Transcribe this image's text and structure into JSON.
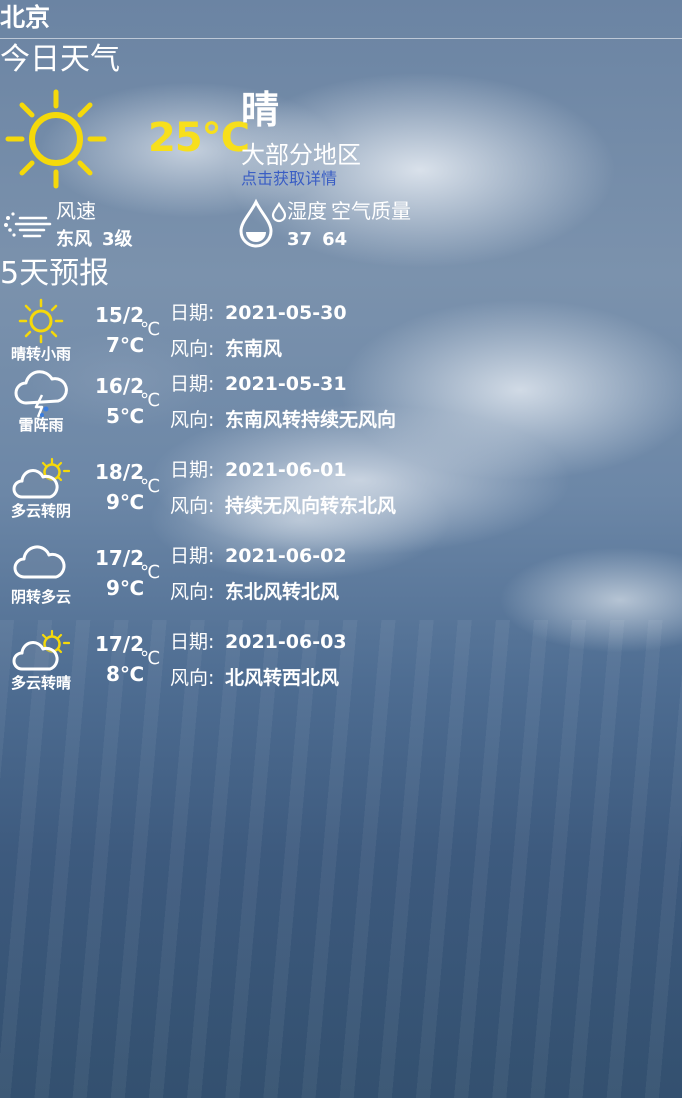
{
  "header": {
    "city": "北京"
  },
  "today": {
    "section_title": "今日天气",
    "weather_icon": "sun-icon",
    "temperature": "25℃",
    "weather": "晴",
    "area": "大部分地区",
    "detail_link": "点击获取详情",
    "wind": {
      "icon": "wind-icon",
      "label": "风速",
      "direction": "东风",
      "level": "3级"
    },
    "humidity": {
      "icon": "water-drop-icon",
      "label": "湿度",
      "aqi_label": "空气质量",
      "humidity_value": "37",
      "aqi_value": "64"
    }
  },
  "forecast": {
    "section_title": "5天预报",
    "date_label": "日期:",
    "wind_label": "风向:",
    "temp_unit": "℃",
    "days": [
      {
        "icon": "sun-to-light-rain-icon",
        "condition": "晴转小雨",
        "high": "15/2",
        "low": "7℃",
        "date": "2021-05-30",
        "wind": "东南风"
      },
      {
        "icon": "thunderstorm-icon",
        "condition": "雷阵雨",
        "high": "16/2",
        "low": "5℃",
        "date": "2021-05-31",
        "wind": "东南风转持续无风向"
      },
      {
        "icon": "partly-cloudy-icon",
        "condition": "多云转阴",
        "high": "18/2",
        "low": "9℃",
        "date": "2021-06-01",
        "wind": "持续无风向转东北风"
      },
      {
        "icon": "overcast-icon",
        "condition": "阴转多云",
        "high": "17/2",
        "low": "9℃",
        "date": "2021-06-02",
        "wind": "东北风转北风"
      },
      {
        "icon": "partly-cloudy-icon",
        "condition": "多云转晴",
        "high": "17/2",
        "low": "8℃",
        "date": "2021-06-03",
        "wind": "北风转西北风"
      }
    ]
  },
  "colors": {
    "accent_temperature": "#f7df1c",
    "link": "#3a5ec4",
    "text": "#ffffff"
  }
}
